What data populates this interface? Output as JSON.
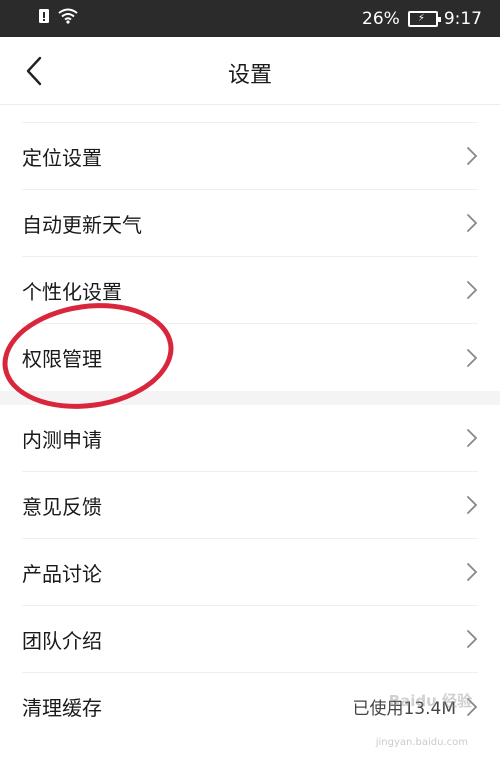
{
  "status_bar": {
    "battery": "26%",
    "time": "9:17"
  },
  "header": {
    "title": "设置"
  },
  "settings_group_1": [
    {
      "label": "定位设置"
    },
    {
      "label": "自动更新天气"
    },
    {
      "label": "个性化设置"
    },
    {
      "label": "权限管理"
    }
  ],
  "settings_group_2": [
    {
      "label": "内测申请"
    },
    {
      "label": "意见反馈"
    },
    {
      "label": "产品讨论"
    },
    {
      "label": "团队介绍"
    },
    {
      "label": "清理缓存",
      "value": "已使用13.4M"
    }
  ],
  "watermark": {
    "text": "Baidu 经验",
    "url": "jingyan.baidu.com"
  },
  "colors": {
    "status_bar_bg": "#2b2b2b",
    "highlight": "#d8263c"
  }
}
